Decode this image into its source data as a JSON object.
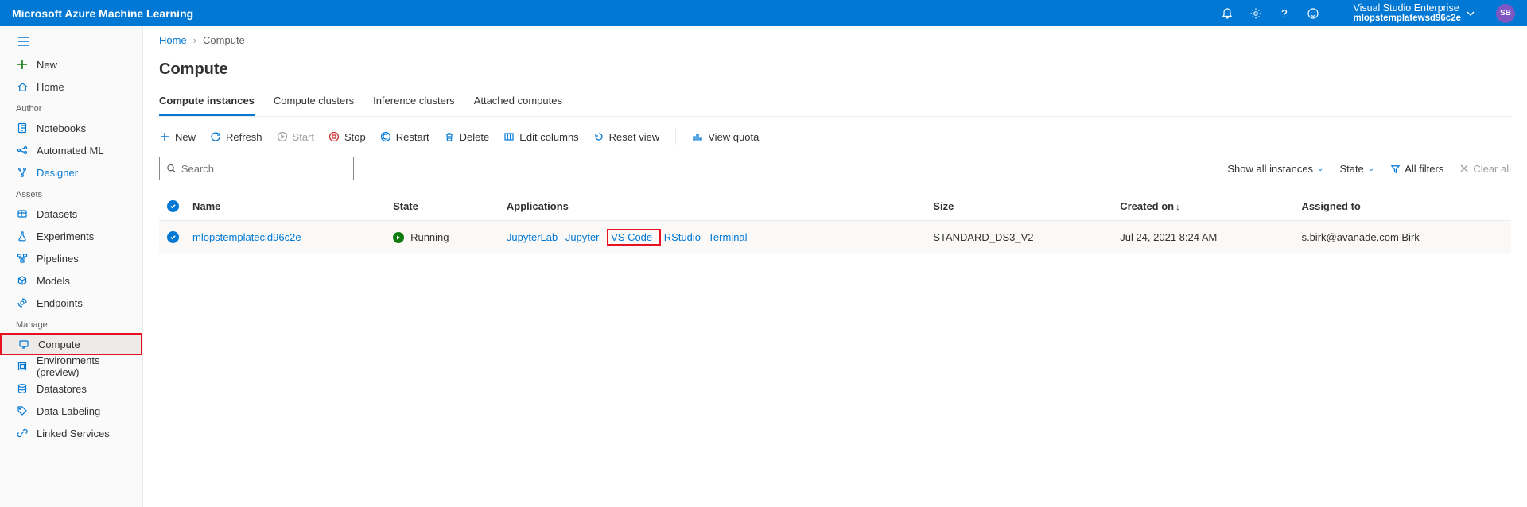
{
  "header": {
    "product": "Microsoft Azure Machine Learning",
    "subscription_line1": "Visual Studio Enterprise",
    "subscription_line2": "mlopstemplatewsd96c2e",
    "avatar_initials": "SB"
  },
  "sidebar": {
    "new": "New",
    "home": "Home",
    "section_author": "Author",
    "notebooks": "Notebooks",
    "automated_ml": "Automated ML",
    "designer": "Designer",
    "section_assets": "Assets",
    "datasets": "Datasets",
    "experiments": "Experiments",
    "pipelines": "Pipelines",
    "models": "Models",
    "endpoints": "Endpoints",
    "section_manage": "Manage",
    "compute": "Compute",
    "environments": "Environments (preview)",
    "datastores": "Datastores",
    "data_labeling": "Data Labeling",
    "linked_services": "Linked Services"
  },
  "breadcrumb": {
    "home": "Home",
    "current": "Compute"
  },
  "page": {
    "title": "Compute"
  },
  "tabs": {
    "instances": "Compute instances",
    "clusters": "Compute clusters",
    "inference": "Inference clusters",
    "attached": "Attached computes"
  },
  "toolbar": {
    "new": "New",
    "refresh": "Refresh",
    "start": "Start",
    "stop": "Stop",
    "restart": "Restart",
    "delete": "Delete",
    "edit_columns": "Edit columns",
    "reset_view": "Reset view",
    "view_quota": "View quota"
  },
  "search": {
    "placeholder": "Search"
  },
  "filters": {
    "show_all": "Show all instances",
    "state": "State",
    "all_filters": "All filters",
    "clear_all": "Clear all"
  },
  "columns": {
    "name": "Name",
    "state": "State",
    "applications": "Applications",
    "size": "Size",
    "created_on": "Created on",
    "assigned_to": "Assigned to"
  },
  "rows": [
    {
      "name": "mlopstemplatecid96c2e",
      "state": "Running",
      "apps": {
        "jupyterlab": "JupyterLab",
        "jupyter": "Jupyter",
        "vscode": "VS Code",
        "rstudio": "RStudio",
        "terminal": "Terminal"
      },
      "size": "STANDARD_DS3_V2",
      "created_on": "Jul 24, 2021 8:24 AM",
      "assigned_to": "s.birk@avanade.com Birk"
    }
  ]
}
